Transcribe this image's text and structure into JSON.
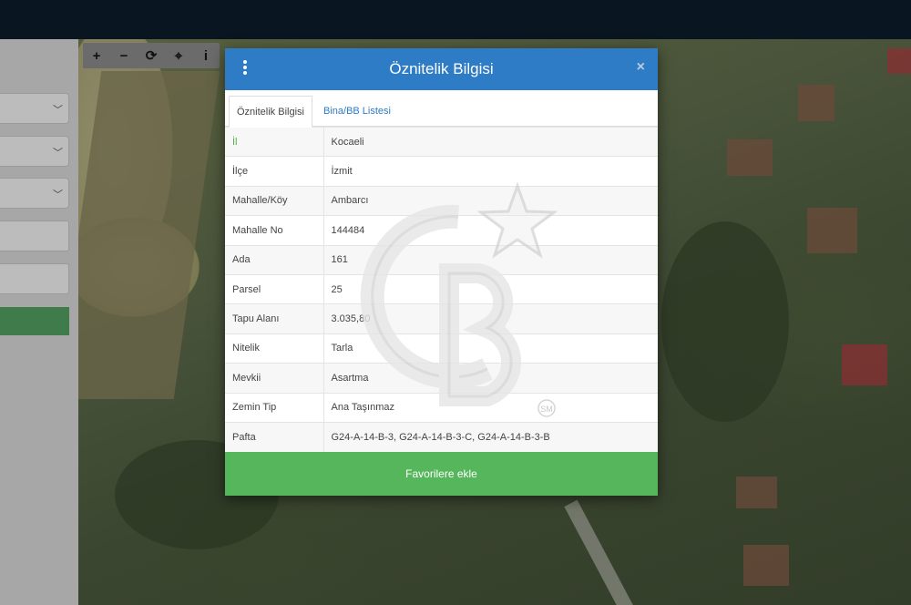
{
  "toolbar": {
    "zoom_in": "+",
    "zoom_out": "−",
    "refresh": "⟳",
    "locate": "⌖",
    "info": "i"
  },
  "modal": {
    "title": "Öznitelik Bilgisi",
    "close": "×",
    "tabs": [
      {
        "label": "Öznitelik Bilgisi",
        "active": true
      },
      {
        "label": "Bina/BB Listesi",
        "active": false
      }
    ],
    "rows": [
      {
        "key": "İl",
        "value": "Kocaeli"
      },
      {
        "key": "İlçe",
        "value": "İzmit"
      },
      {
        "key": "Mahalle/Köy",
        "value": "Ambarcı"
      },
      {
        "key": "Mahalle No",
        "value": "144484"
      },
      {
        "key": "Ada",
        "value": "161"
      },
      {
        "key": "Parsel",
        "value": "25"
      },
      {
        "key": "Tapu Alanı",
        "value": "3.035,80"
      },
      {
        "key": "Nitelik",
        "value": "Tarla"
      },
      {
        "key": "Mevkii",
        "value": "Asartma"
      },
      {
        "key": "Zemin Tip",
        "value": "Ana Taşınmaz"
      },
      {
        "key": "Pafta",
        "value": "G24-A-14-B-3, G24-A-14-B-3-C, G24-A-14-B-3-B"
      }
    ],
    "favorite_label": "Favorilere ekle"
  },
  "watermark": {
    "mark": "SM"
  },
  "colors": {
    "header": "#2e7bc6",
    "favorite": "#55b65b",
    "topbar": "#0a1522"
  }
}
